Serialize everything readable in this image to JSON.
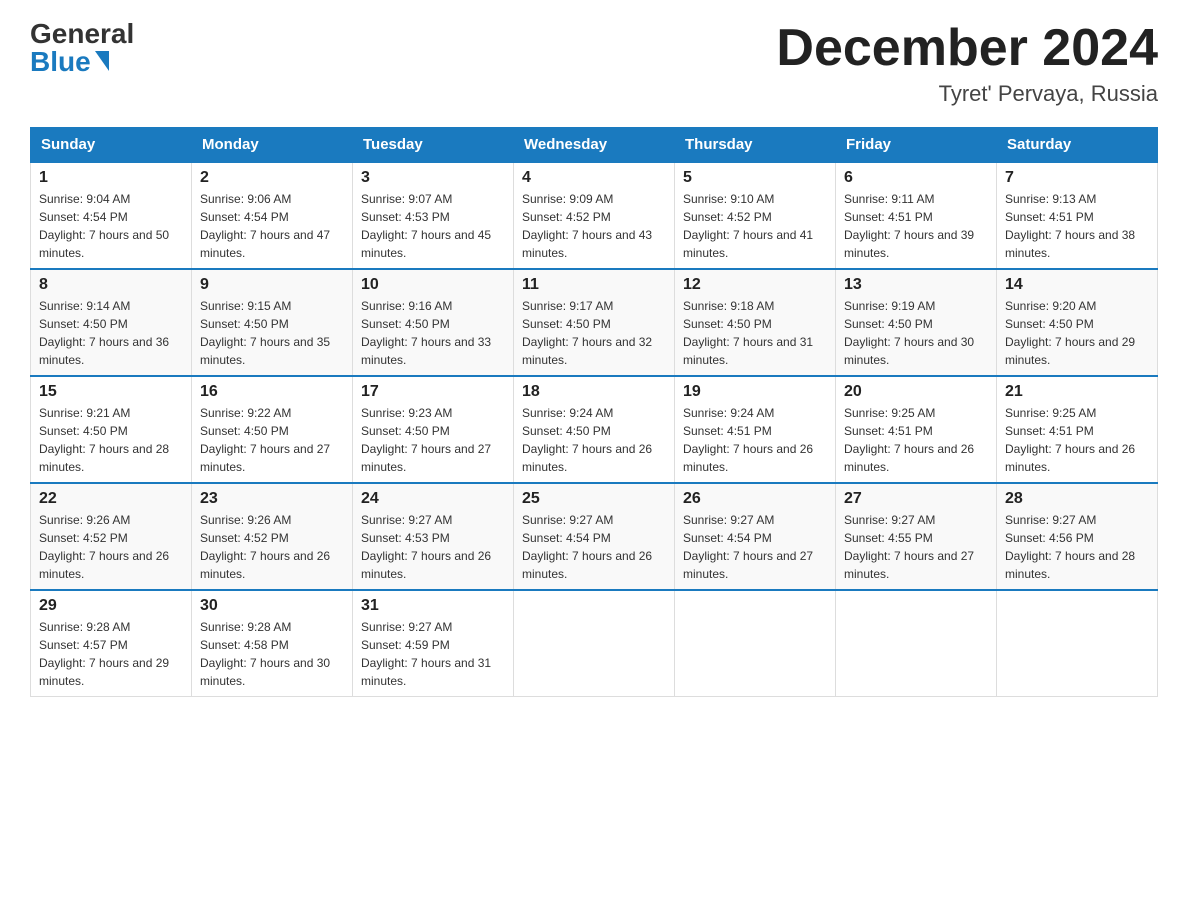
{
  "header": {
    "logo_general": "General",
    "logo_blue": "Blue",
    "month_title": "December 2024",
    "location": "Tyret' Pervaya, Russia"
  },
  "weekdays": [
    "Sunday",
    "Monday",
    "Tuesday",
    "Wednesday",
    "Thursday",
    "Friday",
    "Saturday"
  ],
  "weeks": [
    [
      {
        "day": "1",
        "sunrise": "9:04 AM",
        "sunset": "4:54 PM",
        "daylight": "7 hours and 50 minutes."
      },
      {
        "day": "2",
        "sunrise": "9:06 AM",
        "sunset": "4:54 PM",
        "daylight": "7 hours and 47 minutes."
      },
      {
        "day": "3",
        "sunrise": "9:07 AM",
        "sunset": "4:53 PM",
        "daylight": "7 hours and 45 minutes."
      },
      {
        "day": "4",
        "sunrise": "9:09 AM",
        "sunset": "4:52 PM",
        "daylight": "7 hours and 43 minutes."
      },
      {
        "day": "5",
        "sunrise": "9:10 AM",
        "sunset": "4:52 PM",
        "daylight": "7 hours and 41 minutes."
      },
      {
        "day": "6",
        "sunrise": "9:11 AM",
        "sunset": "4:51 PM",
        "daylight": "7 hours and 39 minutes."
      },
      {
        "day": "7",
        "sunrise": "9:13 AM",
        "sunset": "4:51 PM",
        "daylight": "7 hours and 38 minutes."
      }
    ],
    [
      {
        "day": "8",
        "sunrise": "9:14 AM",
        "sunset": "4:50 PM",
        "daylight": "7 hours and 36 minutes."
      },
      {
        "day": "9",
        "sunrise": "9:15 AM",
        "sunset": "4:50 PM",
        "daylight": "7 hours and 35 minutes."
      },
      {
        "day": "10",
        "sunrise": "9:16 AM",
        "sunset": "4:50 PM",
        "daylight": "7 hours and 33 minutes."
      },
      {
        "day": "11",
        "sunrise": "9:17 AM",
        "sunset": "4:50 PM",
        "daylight": "7 hours and 32 minutes."
      },
      {
        "day": "12",
        "sunrise": "9:18 AM",
        "sunset": "4:50 PM",
        "daylight": "7 hours and 31 minutes."
      },
      {
        "day": "13",
        "sunrise": "9:19 AM",
        "sunset": "4:50 PM",
        "daylight": "7 hours and 30 minutes."
      },
      {
        "day": "14",
        "sunrise": "9:20 AM",
        "sunset": "4:50 PM",
        "daylight": "7 hours and 29 minutes."
      }
    ],
    [
      {
        "day": "15",
        "sunrise": "9:21 AM",
        "sunset": "4:50 PM",
        "daylight": "7 hours and 28 minutes."
      },
      {
        "day": "16",
        "sunrise": "9:22 AM",
        "sunset": "4:50 PM",
        "daylight": "7 hours and 27 minutes."
      },
      {
        "day": "17",
        "sunrise": "9:23 AM",
        "sunset": "4:50 PM",
        "daylight": "7 hours and 27 minutes."
      },
      {
        "day": "18",
        "sunrise": "9:24 AM",
        "sunset": "4:50 PM",
        "daylight": "7 hours and 26 minutes."
      },
      {
        "day": "19",
        "sunrise": "9:24 AM",
        "sunset": "4:51 PM",
        "daylight": "7 hours and 26 minutes."
      },
      {
        "day": "20",
        "sunrise": "9:25 AM",
        "sunset": "4:51 PM",
        "daylight": "7 hours and 26 minutes."
      },
      {
        "day": "21",
        "sunrise": "9:25 AM",
        "sunset": "4:51 PM",
        "daylight": "7 hours and 26 minutes."
      }
    ],
    [
      {
        "day": "22",
        "sunrise": "9:26 AM",
        "sunset": "4:52 PM",
        "daylight": "7 hours and 26 minutes."
      },
      {
        "day": "23",
        "sunrise": "9:26 AM",
        "sunset": "4:52 PM",
        "daylight": "7 hours and 26 minutes."
      },
      {
        "day": "24",
        "sunrise": "9:27 AM",
        "sunset": "4:53 PM",
        "daylight": "7 hours and 26 minutes."
      },
      {
        "day": "25",
        "sunrise": "9:27 AM",
        "sunset": "4:54 PM",
        "daylight": "7 hours and 26 minutes."
      },
      {
        "day": "26",
        "sunrise": "9:27 AM",
        "sunset": "4:54 PM",
        "daylight": "7 hours and 27 minutes."
      },
      {
        "day": "27",
        "sunrise": "9:27 AM",
        "sunset": "4:55 PM",
        "daylight": "7 hours and 27 minutes."
      },
      {
        "day": "28",
        "sunrise": "9:27 AM",
        "sunset": "4:56 PM",
        "daylight": "7 hours and 28 minutes."
      }
    ],
    [
      {
        "day": "29",
        "sunrise": "9:28 AM",
        "sunset": "4:57 PM",
        "daylight": "7 hours and 29 minutes."
      },
      {
        "day": "30",
        "sunrise": "9:28 AM",
        "sunset": "4:58 PM",
        "daylight": "7 hours and 30 minutes."
      },
      {
        "day": "31",
        "sunrise": "9:27 AM",
        "sunset": "4:59 PM",
        "daylight": "7 hours and 31 minutes."
      },
      null,
      null,
      null,
      null
    ]
  ]
}
